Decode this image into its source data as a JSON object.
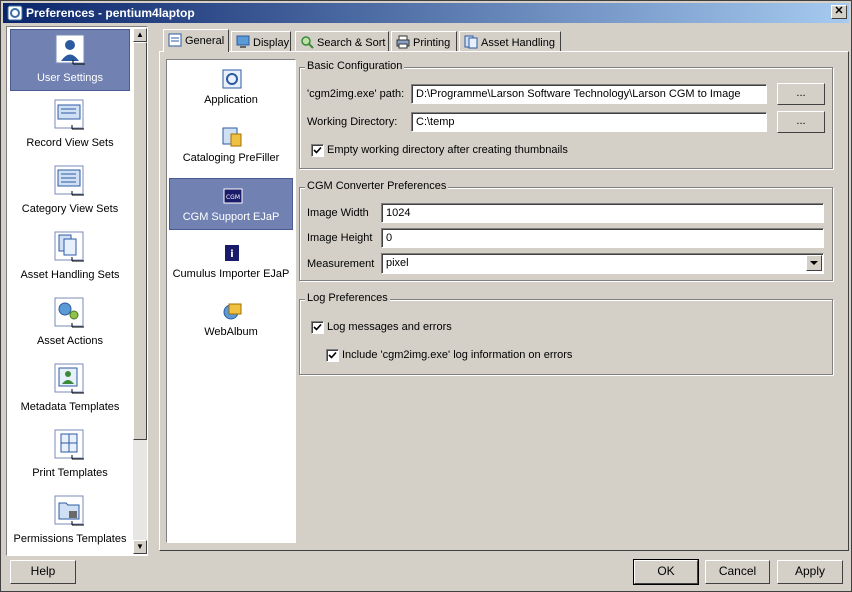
{
  "window": {
    "title": "Preferences - pentium4laptop"
  },
  "sidebar": {
    "items": [
      {
        "label": "User Settings",
        "icon": "user-settings-icon",
        "selected": true
      },
      {
        "label": "Record View Sets",
        "icon": "record-view-sets-icon"
      },
      {
        "label": "Category View Sets",
        "icon": "category-view-sets-icon"
      },
      {
        "label": "Asset Handling Sets",
        "icon": "asset-handling-sets-icon"
      },
      {
        "label": "Asset Actions",
        "icon": "asset-actions-icon"
      },
      {
        "label": "Metadata Templates",
        "icon": "metadata-templates-icon"
      },
      {
        "label": "Print Templates",
        "icon": "print-templates-icon"
      },
      {
        "label": "Permissions Templates",
        "icon": "permissions-templates-icon"
      }
    ]
  },
  "tabs": [
    {
      "label": "General",
      "active": true
    },
    {
      "label": "Display"
    },
    {
      "label": "Search & Sort"
    },
    {
      "label": "Printing"
    },
    {
      "label": "Asset Handling"
    }
  ],
  "sublist": {
    "items": [
      {
        "label": "Application"
      },
      {
        "label": "Cataloging PreFiller"
      },
      {
        "label": "CGM Support EJaP",
        "selected": true
      },
      {
        "label": "Cumulus Importer EJaP"
      },
      {
        "label": "WebAlbum"
      }
    ]
  },
  "basic": {
    "title": "Basic Configuration",
    "path_label": "'cgm2img.exe' path:",
    "path_value": "D:\\Programme\\Larson Software Technology\\Larson CGM to Image",
    "browse1": "...",
    "workdir_label": "Working Directory:",
    "workdir_value": "C:\\temp",
    "browse2": "...",
    "empty_label": "Empty working directory after creating thumbnails",
    "empty_checked": true
  },
  "converter": {
    "title": "CGM Converter Preferences",
    "width_label": "Image Width",
    "width_value": "1024",
    "height_label": "Image Height",
    "height_value": "0",
    "measure_label": "Measurement",
    "measure_value": "pixel"
  },
  "log": {
    "title": "Log Preferences",
    "log_label": "Log messages and errors",
    "log_checked": true,
    "include_label": "Include 'cgm2img.exe' log information on errors",
    "include_checked": true
  },
  "buttons": {
    "help": "Help",
    "ok": "OK",
    "cancel": "Cancel",
    "apply": "Apply"
  },
  "colors": {
    "selection": "#7181b2",
    "title_start": "#0a246a",
    "title_end": "#a6caf0"
  }
}
